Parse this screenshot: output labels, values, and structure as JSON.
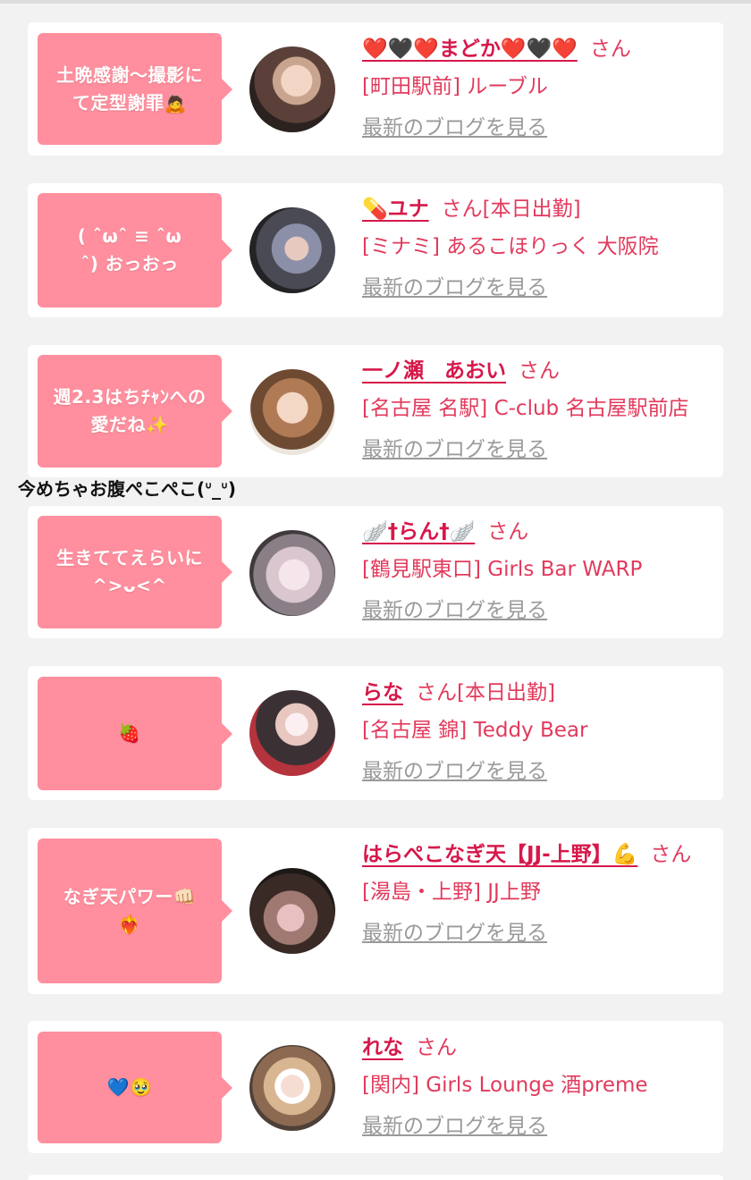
{
  "entries": [
    {
      "bubble": "土晩感謝〜撮影に\nて定型謝罪🙇",
      "name": "❤️🖤❤️まどか❤️🖤❤️",
      "san": "さん",
      "extra": "",
      "shop": "[町田駅前] ルーブル",
      "blog": "最新のブログを見る"
    },
    {
      "bubble": "( ˆωˆ ≡ ˆω\nˆ) おっおっ",
      "name": "💊ユナ",
      "san": "さん",
      "extra": "[本日出勤]",
      "shop": "[ミナミ] あるこほりっく 大阪院",
      "blog": "最新のブログを見る"
    },
    {
      "bubble": "週2.3はちﾁｬﾝへの\n愛だね✨",
      "name": "一ノ瀬　あおい",
      "san": "さん",
      "extra": "",
      "shop": "[名古屋 名駅] C-club 名古屋駅前店",
      "blog": "最新のブログを見る"
    },
    {
      "bubble": "生きててえらいに\n^>ᴗ<^",
      "name": "🪽†らん†🪽",
      "san": "さん",
      "extra": "",
      "shop": "[鶴見駅東口] Girls Bar WARP",
      "blog": "最新のブログを見る"
    },
    {
      "bubble": "🍓",
      "name": "らな",
      "san": "さん",
      "extra": "[本日出勤]",
      "shop": "[名古屋 錦] Teddy Bear",
      "blog": "最新のブログを見る"
    },
    {
      "bubble": "なぎ天パワー👊🏻\n❤️‍🔥",
      "name": "はらぺこなぎ天【JJ-上野】💪",
      "san": "さん",
      "extra": "",
      "shop": "[湯島・上野] JJ上野",
      "blog": "最新のブログを見る"
    },
    {
      "bubble": "💙🥹",
      "name": "れな",
      "san": "さん",
      "extra": "",
      "shop": "[関内] Girls Lounge 酒preme",
      "blog": "最新のブログを見る"
    }
  ],
  "floating_text": "今めちゃお腹ぺこぺこ(ᐡ_ᐡ)",
  "colors": {
    "background": "#f2f2f2",
    "card": "#ffffff",
    "bubble": "#ff8f9e",
    "name": "#d6184a",
    "shop": "#e23a5c",
    "blog_link": "#9a9a9a"
  },
  "icons": [
    "avatar-photo"
  ]
}
